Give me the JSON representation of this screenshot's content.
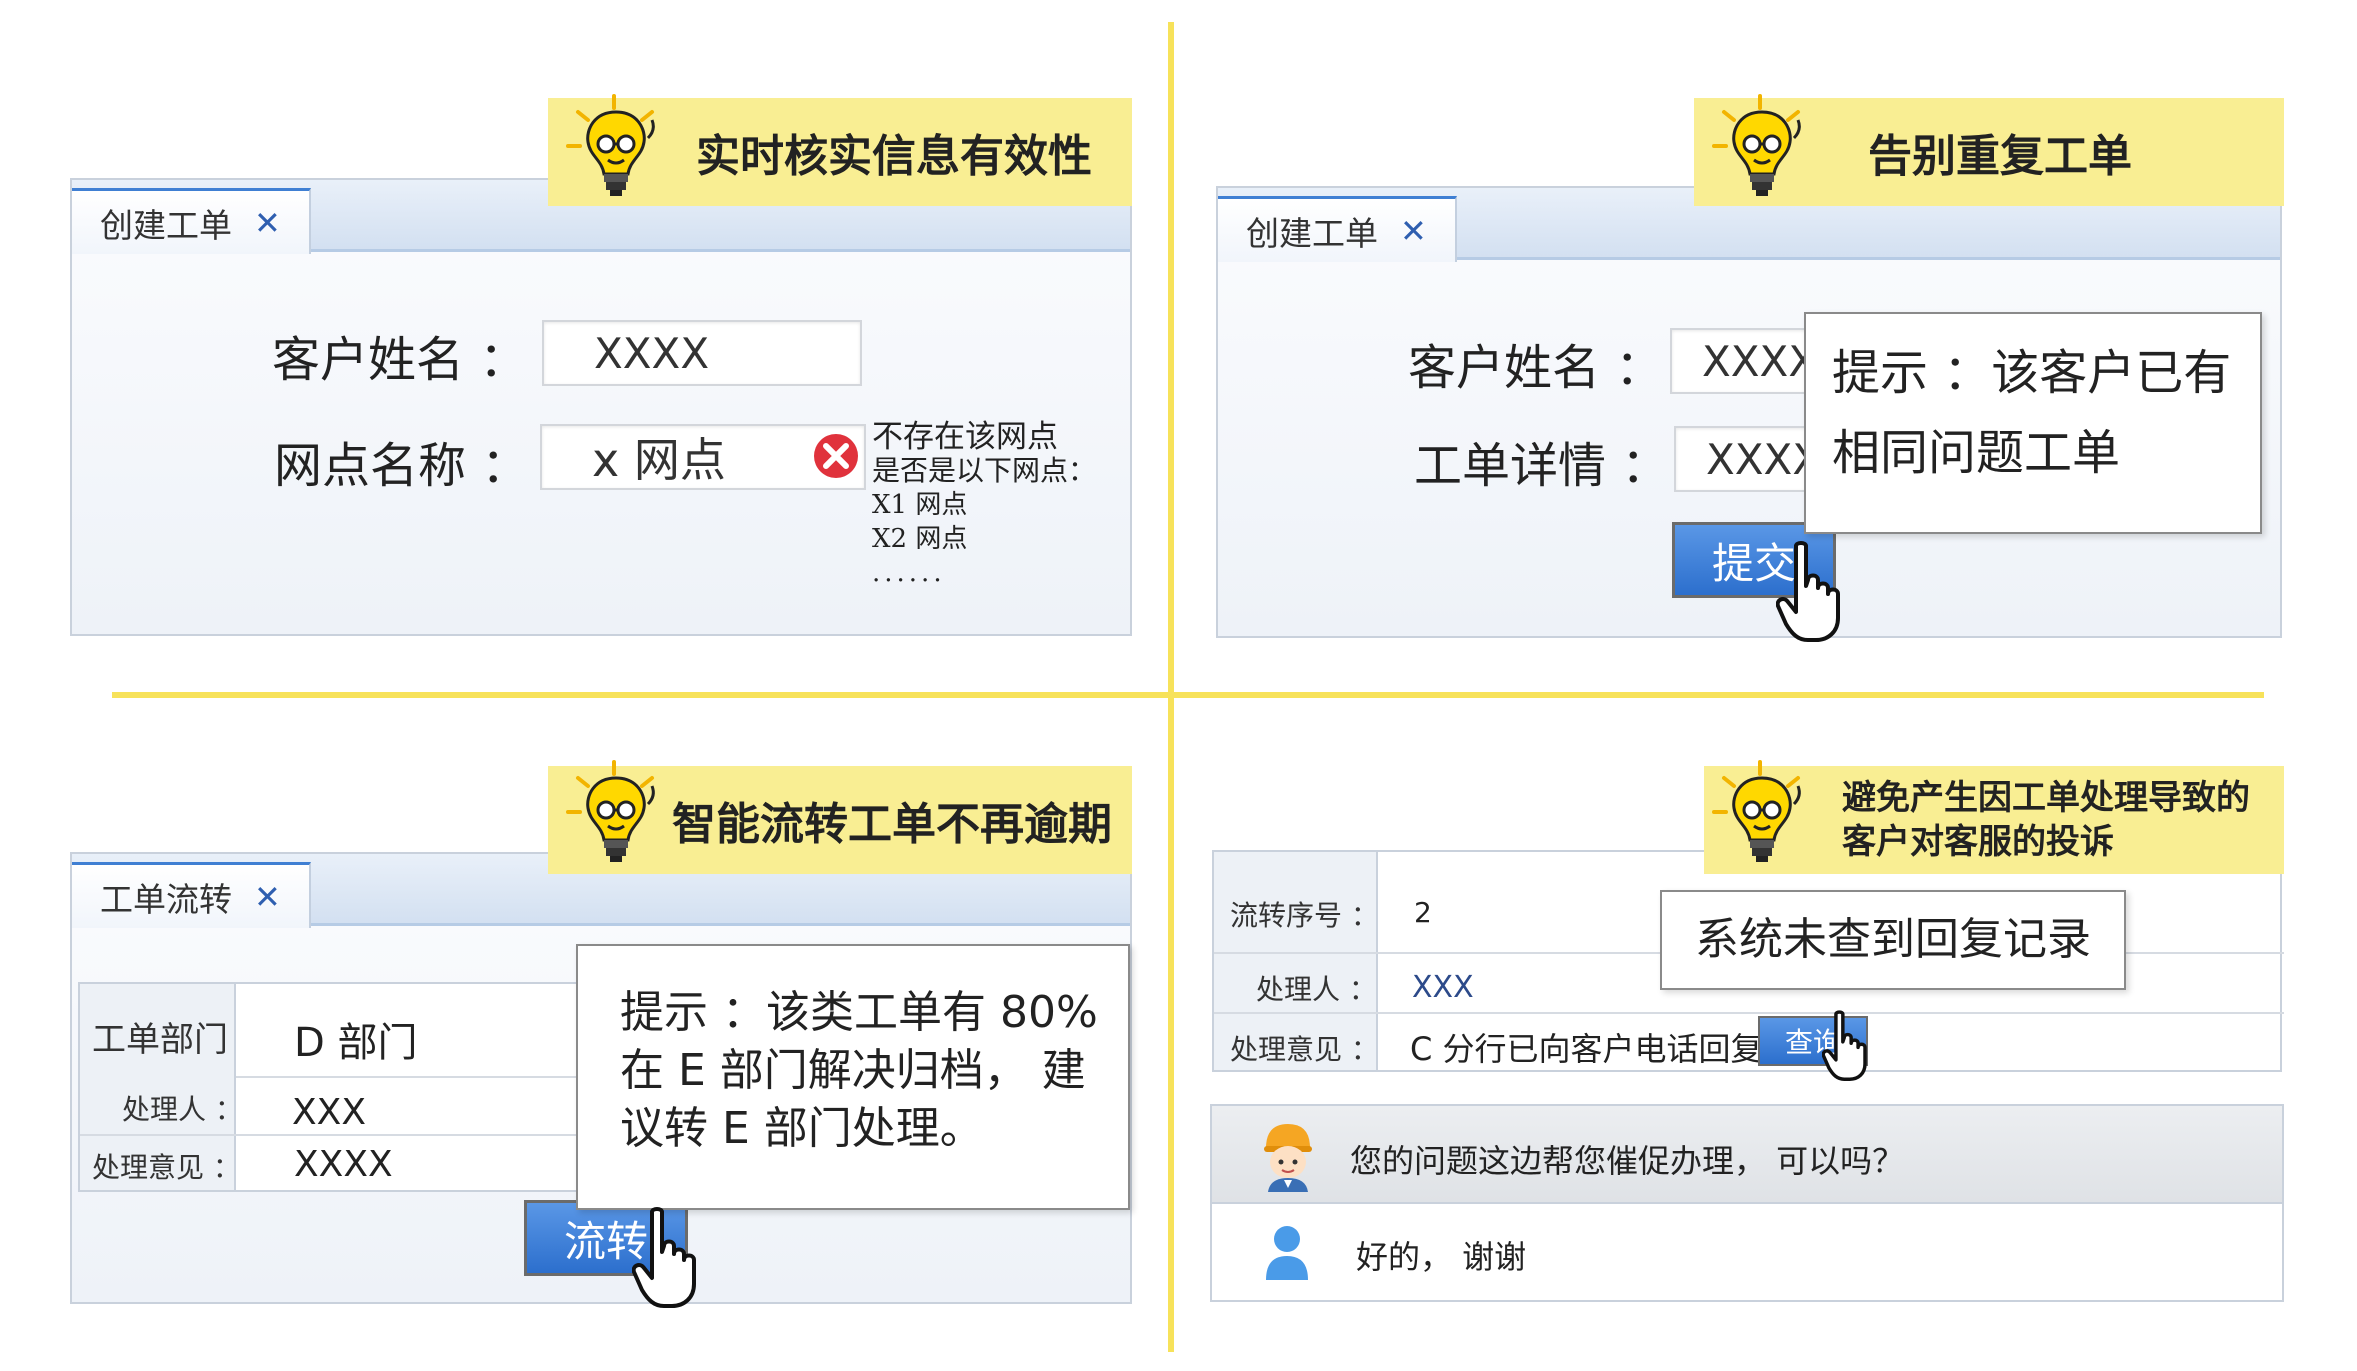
{
  "q1": {
    "banner_title": "实时核实信息有效性",
    "tab_label": "创建工单",
    "tab_close": "✕",
    "customer_label": "客户姓名 ：",
    "customer_value": "XXXX",
    "branch_label": "网点名称 ：",
    "branch_value": "x 网点",
    "error_lines": [
      "不存在该网点",
      "是否是以下网点：",
      "X1 网点",
      "X2 网点",
      "......"
    ]
  },
  "q2": {
    "banner_title": "告别重复工单",
    "tab_label": "创建工单",
    "tab_close": "✕",
    "customer_label": "客户姓名 ：",
    "customer_value": "XXXX",
    "detail_label": "工单详情 ：",
    "detail_value": "XXXX",
    "submit_label": "提交",
    "tip_line1": "提示 ：该客户已有",
    "tip_line2": "相同问题工单"
  },
  "q3": {
    "banner_title": "智能流转工单不再逾期",
    "tab_label": "工单流转",
    "tab_close": "✕",
    "dept_label": "工单部门",
    "dept_value": "D 部门",
    "handler_label": "处理人 ：",
    "handler_value": "XXX",
    "opinion_label": "处理意见 ：",
    "opinion_value": "XXXX",
    "tip_lines": [
      "提示 ：该类工单有 80%",
      "在 E 部门解决归档， 建",
      "议转 E 部门处理。"
    ],
    "transfer_label": "流转"
  },
  "q4": {
    "banner_line1": "避免产生因工单处理导致的",
    "banner_line2": "客户对客服的投诉",
    "seq_label": "流转序号 ：",
    "seq_value": "2",
    "handler_label": "处理人 ：",
    "handler_value": "XXX",
    "opinion_label": "处理意见 ：",
    "opinion_value": "C 分行已向客户电话回复",
    "query_label": "查询",
    "notice": "系统未查到回复记录",
    "chat_agent": "您的问题这边帮您催促办理， 可以吗？",
    "chat_user": "好的， 谢谢"
  },
  "colors": {
    "accent": "#f7e25a",
    "banner": "#f9ee93",
    "button": "#2c6fcd",
    "error": "#e0323c"
  }
}
